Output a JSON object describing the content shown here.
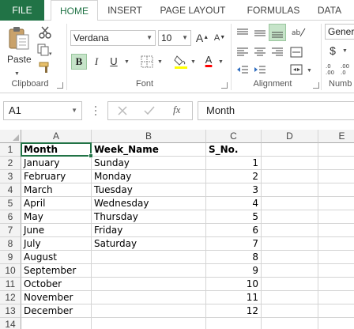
{
  "tabs": [
    "FILE",
    "HOME",
    "INSERT",
    "PAGE LAYOUT",
    "FORMULAS",
    "DATA"
  ],
  "ribbon": {
    "paste_label": "Paste",
    "font_name": "Verdana",
    "font_size": "10",
    "number_format": "Genera",
    "groups": {
      "clipboard": "Clipboard",
      "font": "Font",
      "alignment": "Alignment",
      "number": "Numb"
    },
    "buttons": {
      "bold": "B",
      "italic": "I",
      "underline": "U",
      "grow_font": "A",
      "shrink_font": "A",
      "font_color": "A",
      "currency": "$"
    },
    "colors": {
      "accent": "#217346",
      "highlight": "#ffff00",
      "font_color": "#ff0000"
    }
  },
  "formula_bar": {
    "name_box": "A1",
    "fx_label": "fx",
    "content": "Month"
  },
  "columns": [
    "A",
    "B",
    "C",
    "D",
    "E"
  ],
  "rows": [
    "1",
    "2",
    "3",
    "4",
    "5",
    "6",
    "7",
    "8",
    "9",
    "10",
    "11",
    "12",
    "13",
    "14"
  ],
  "sheet": [
    [
      "Month",
      "Week_Name",
      "S_No."
    ],
    [
      "January",
      "Sunday",
      "1"
    ],
    [
      "February",
      "Monday",
      "2"
    ],
    [
      "March",
      "Tuesday",
      "3"
    ],
    [
      "April",
      "Wednesday",
      "4"
    ],
    [
      "May",
      "Thursday",
      "5"
    ],
    [
      "June",
      "Friday",
      "6"
    ],
    [
      "July",
      "Saturday",
      "7"
    ],
    [
      "August",
      "",
      "8"
    ],
    [
      "September",
      "",
      "9"
    ],
    [
      "October",
      "",
      "10"
    ],
    [
      "November",
      "",
      "11"
    ],
    [
      "December",
      "",
      "12"
    ],
    [
      "",
      "",
      ""
    ]
  ]
}
